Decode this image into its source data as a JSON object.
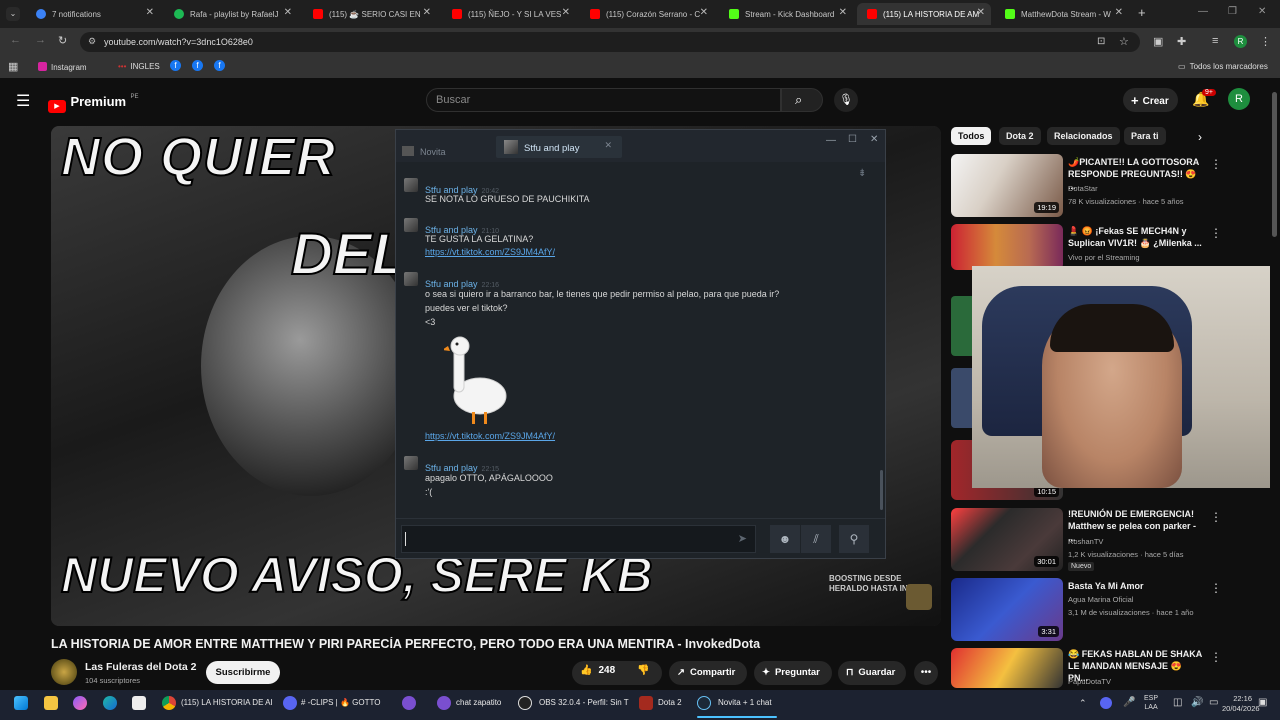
{
  "browser": {
    "tabs": [
      {
        "label": "7 notifications",
        "color": "#3b82f6"
      },
      {
        "label": "Rafa - playlist by RafaelJ",
        "color": "#1db954"
      },
      {
        "label": "(115) ☕ SERIO CASI EN",
        "color": "#ff0000"
      },
      {
        "label": "(115) ÑEJO - Y SI LA VES",
        "color": "#ff0000"
      },
      {
        "label": "(115) Corazón Serrano - C",
        "color": "#ff0000"
      },
      {
        "label": "Stream - Kick Dashboard",
        "color": "#53fc18"
      },
      {
        "label": "(115) LA HISTORIA DE AM",
        "color": "#ff0000"
      },
      {
        "label": "MatthewDota Stream - W",
        "color": "#53fc18"
      }
    ],
    "new_tab": "+",
    "url": "youtube.com/watch?v=3dnc1O628e0",
    "bookmarks": [
      "Instagram",
      "INGLES"
    ],
    "all_bookmarks": "Todos los marcadores"
  },
  "youtube": {
    "logo": "Premium",
    "region": "PE",
    "search_placeholder": "Buscar",
    "create_label": "Crear",
    "notif_badge": "9+",
    "avatar_letter": "R",
    "video_title": "LA HISTORIA DE AMOR ENTRE MATTHEW Y PIRI PARECÍA PERFECTO, PERO TODO ERA UNA MENTIRA - InvokedDota",
    "channel_name": "Las Fuleras del Dota 2",
    "subscribers": "104 suscriptores",
    "subscribe_label": "Suscribirme",
    "likes": "248",
    "share_label": "Compartir",
    "ask_label": "Preguntar",
    "save_label": "Guardar",
    "thumb_caption_top": "NO QUIER",
    "thumb_caption_mid": "DEL A",
    "thumb_caption_bottom": "NUEVO AVISO, SERE KB",
    "thumb_corner": "BOOSTING DESDE HERALDO HASTA INM",
    "chips": [
      "Todos",
      "Dota 2",
      "Relacionados",
      "Para ti"
    ],
    "recommendations": [
      {
        "title": "🌶️PICANTE!! LA GOTTOSORA RESPONDE PREGUNTAS!! 😍 ...",
        "channel": "DotaStar",
        "meta": "78 K visualizaciones · hace 5 años",
        "duration": "19:19"
      },
      {
        "title": "💄 😡 ¡Fekas SE MECH4N y Suplican VIV1R! 🎂 ¿Milenka ...",
        "channel": "Vivo por el Streaming",
        "meta": "",
        "duration": ""
      },
      {
        "title": "!REUNIÓN DE EMERGENCIA! Matthew se pelea con parker - ...",
        "channel": "RoshanTV",
        "meta": "1,2 K visualizaciones · hace 5 días",
        "duration": "30:01",
        "badge": "Nuevo"
      },
      {
        "title": "Basta Ya Mi Amor",
        "channel": "Agua Marina Oficial",
        "meta": "3,1 M de visualizaciones · hace 1 año",
        "duration": "3:31"
      },
      {
        "title": "😂 FEKAS HABLAN DE SHAKA LE MANDAN MENSAJE 😍 PN...",
        "channel": "PapuDotaTV",
        "meta": "",
        "duration": ""
      }
    ],
    "partial_duration": "10:15"
  },
  "chat": {
    "inactive_tab": "Novita",
    "active_tab": "Stfu and play",
    "author": "Stfu and play",
    "messages": [
      {
        "time": "20:42",
        "lines": [
          "SE NOTA LO GRUESO DE PAUCHIKITA"
        ]
      },
      {
        "time": "21:10",
        "lines": [
          "TE GUSTA LA GELATINA?"
        ],
        "link": "https://vt.tiktok.com/ZS9JM4AfY/"
      },
      {
        "time": "22:16",
        "lines": [
          "o sea si quiero ir a barranco bar, le tienes que pedir permiso al pelao, para que pueda ir?",
          "puedes ver el tiktok?",
          "<3"
        ],
        "link": "https://vt.tiktok.com/ZS9JM4AfY/"
      },
      {
        "time": "22:15",
        "lines": [
          "apagalo OTTO, APÁGALOOOO",
          ":'("
        ]
      }
    ],
    "send_icon": "➤"
  },
  "taskbar": {
    "items": [
      "(115) LA HISTORIA DE AI",
      "# -CLIPS | 🔥 GOTTO",
      "chat zapatito",
      "OBS 32.0.4 - Perfil: Sin T",
      "Dota 2",
      "Novita + 1 chat"
    ],
    "lang": "ESP",
    "lang2": "LAA",
    "time": "22:16",
    "date": "20/04/2026"
  }
}
